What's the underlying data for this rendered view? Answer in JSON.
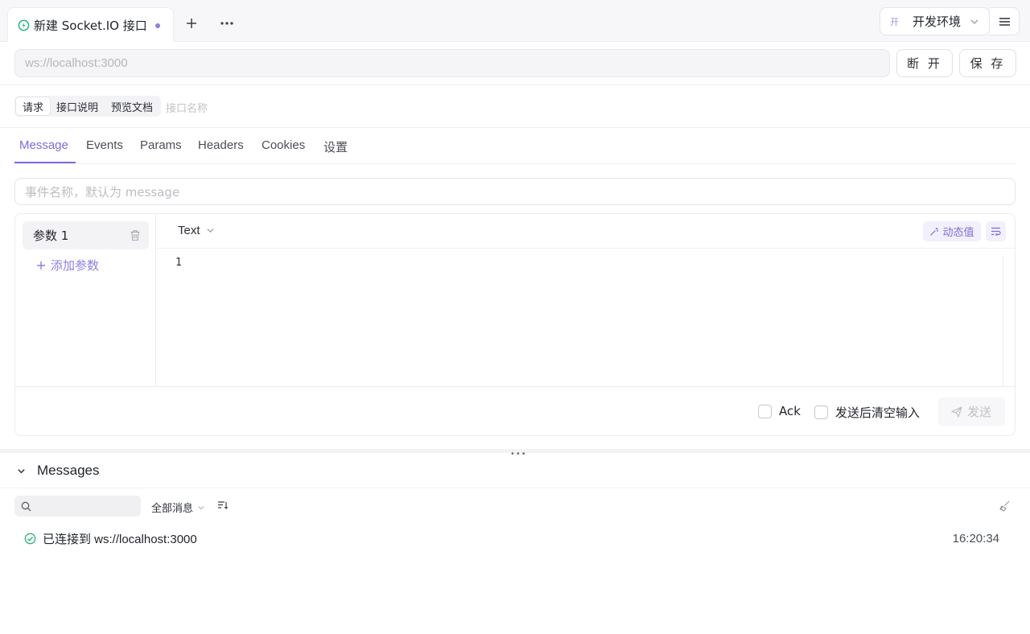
{
  "tabbar": {
    "tab_title": "新建 Socket.IO 接口",
    "environment_badge": "开",
    "environment_name": "开发环境",
    "icons": [
      "socketio-icon",
      "unsaved-dot",
      "plus-icon",
      "more-icon",
      "chevron-down-icon",
      "hamburger-menu-icon"
    ]
  },
  "connection": {
    "url_placeholder": "ws://localhost:3000",
    "disconnect_label": "断 开",
    "save_label": "保 存"
  },
  "segments": {
    "items": [
      "请求",
      "接口说明",
      "预览文档"
    ],
    "active_index": 0,
    "name_placeholder": "接口名称"
  },
  "subtabs": {
    "items": [
      "Message",
      "Events",
      "Params",
      "Headers",
      "Cookies",
      "设置"
    ],
    "active": "Message"
  },
  "event": {
    "placeholder": "事件名称，默认为 message"
  },
  "editor": {
    "param_label": "参数 1",
    "add_param_label": "添加参数",
    "type_label": "Text",
    "dynamic_value_label": "动态值",
    "line_number": "1",
    "ack_label": "Ack",
    "clear_after_send_label": "发送后清空输入",
    "send_label": "发送"
  },
  "messages": {
    "title": "Messages",
    "filter_label": "全部消息",
    "items": [
      {
        "text": "已连接到 ws://localhost:3000",
        "time": "16:20:34",
        "status": "connected"
      }
    ]
  },
  "colors": {
    "accent": "#7b6cd9",
    "success": "#2fb27a",
    "border": "#ececf0"
  }
}
